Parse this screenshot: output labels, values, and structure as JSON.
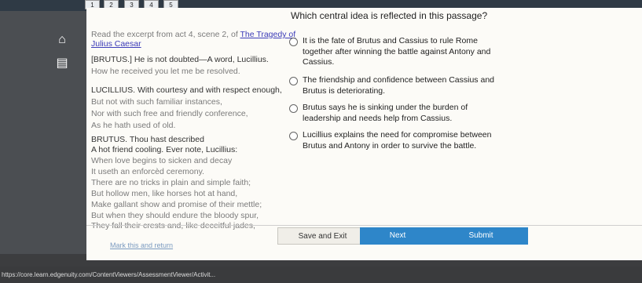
{
  "nav": {
    "question_numbers": [
      "1",
      "2",
      "3",
      "4",
      "5"
    ]
  },
  "passage": {
    "intro": "Read the excerpt from act 4, scene 2, of ",
    "play_title_part1": "The Tragedy of",
    "play_title_part2": "Julius Caesar",
    "lines": [
      "[BRUTUS.] He is not doubted—A word, Lucillius.",
      "How he received you let me be resolved.",
      "LUCILLIUS. With courtesy and with respect enough,",
      "But not with such familiar instances,",
      "Nor with such free and friendly conference,",
      "As he hath used of old.",
      "BRUTUS. Thou hast described",
      "A hot friend cooling. Ever note, Lucillius:",
      "When love begins to sicken and decay",
      "It useth an enforcèd ceremony.",
      "There are no tricks in plain and simple faith;",
      "But hollow men, like horses hot at hand,",
      "Make gallant show and promise of their mettle;",
      "But when they should endure the bloody spur,",
      "They fall their crests and, like deceitful jades,"
    ]
  },
  "question": {
    "prompt": "Which central idea is reflected in this passage?",
    "choices": [
      {
        "line1": "It is the fate of Brutus and Cassius to rule Rome",
        "line2": "together after winning the battle against Antony and",
        "line3": "Cassius."
      },
      {
        "line1": "The friendship and confidence between Cassius and",
        "line2": "Brutus is deteriorating.",
        "line3": ""
      },
      {
        "line1": "Brutus says he is sinking under the burden of",
        "line2": "leadership and needs help from Cassius.",
        "line3": ""
      },
      {
        "line1": "Lucillius explains the need for compromise between",
        "line2": "Brutus and Antony in order to survive the battle.",
        "line3": ""
      }
    ]
  },
  "footer": {
    "mark_link": "Mark this and return",
    "save_label": "Save and Exit",
    "next_label": "Next",
    "submit_label": "Submit"
  },
  "status_url": "https://core.learn.edgenuity.com/ContentViewers/AssessmentViewer/Activit..."
}
